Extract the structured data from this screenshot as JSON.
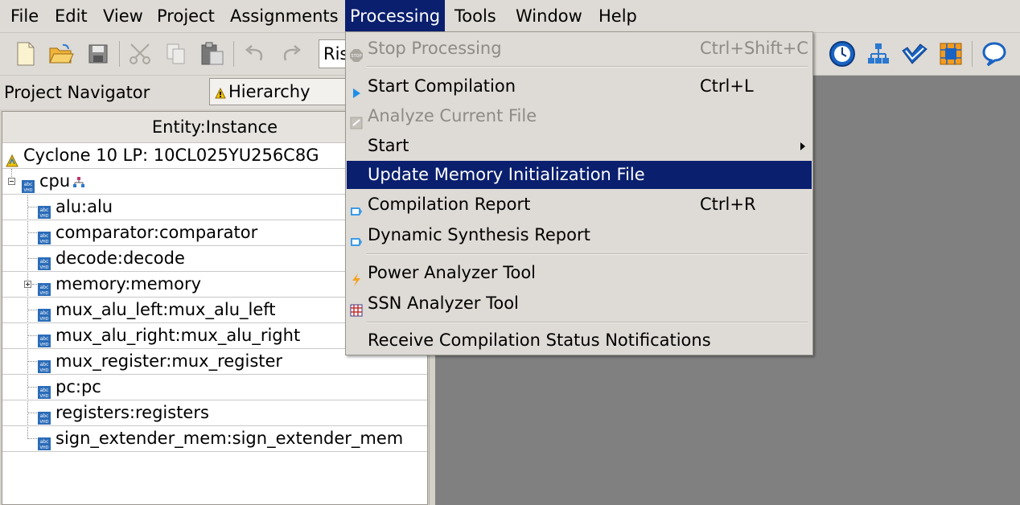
{
  "menubar": {
    "items": [
      "File",
      "Edit",
      "View",
      "Project",
      "Assignments",
      "Processing",
      "Tools",
      "Window",
      "Help"
    ]
  },
  "toolbar": {
    "revision_combo_value": "Ris",
    "left_icons": [
      "new-file-icon",
      "open-folder-icon",
      "save-icon",
      "cut-icon",
      "copy-icon",
      "paste-icon",
      "undo-icon",
      "redo-icon"
    ],
    "right_icons": [
      "timing-analyzer-icon",
      "netlist-viewer-icon",
      "programmer-icon",
      "chip-planner-icon",
      "help-chat-icon"
    ]
  },
  "navigator": {
    "title": "Project Navigator",
    "view_select": "Hierarchy",
    "column_header": "Entity:Instance",
    "device": "Cyclone 10 LP: 10CL025YU256C8G",
    "root": "cpu",
    "children": [
      {
        "label": "alu:alu",
        "expandable": false
      },
      {
        "label": "comparator:comparator",
        "expandable": false
      },
      {
        "label": "decode:decode",
        "expandable": false
      },
      {
        "label": "memory:memory",
        "expandable": true
      },
      {
        "label": "mux_alu_left:mux_alu_left",
        "expandable": false
      },
      {
        "label": "mux_alu_right:mux_alu_right",
        "expandable": false
      },
      {
        "label": "mux_register:mux_register",
        "expandable": false
      },
      {
        "label": "pc:pc",
        "expandable": false
      },
      {
        "label": "registers:registers",
        "expandable": false
      },
      {
        "label": "sign_extender_mem:sign_extender_mem",
        "expandable": false
      }
    ]
  },
  "processing_menu": {
    "items": [
      {
        "label": "Stop Processing",
        "shortcut": "Ctrl+Shift+C",
        "icon": "stop-icon",
        "disabled": true
      },
      {
        "label": "Start Compilation",
        "shortcut": "Ctrl+L",
        "icon": "play-icon"
      },
      {
        "label": "Analyze Current File",
        "shortcut": "",
        "icon": "analyze-file-icon",
        "disabled": true
      },
      {
        "label": "Start",
        "shortcut": "",
        "submenu": true
      },
      {
        "label": "Update Memory Initialization File",
        "shortcut": "",
        "highlighted": true
      },
      {
        "label": "Compilation Report",
        "shortcut": "Ctrl+R",
        "icon": "report-icon"
      },
      {
        "label": "Dynamic Synthesis Report",
        "shortcut": "",
        "icon": "report-icon"
      },
      {
        "label": "Power Analyzer Tool",
        "shortcut": "",
        "icon": "power-icon"
      },
      {
        "label": "SSN Analyzer Tool",
        "shortcut": "",
        "icon": "ssn-grid-icon"
      },
      {
        "label": "Receive Compilation Status Notifications",
        "shortcut": ""
      }
    ]
  },
  "colors": {
    "menu_highlight": "#0a1f6e",
    "workspace": "#808080",
    "chrome": "#dedad5"
  }
}
